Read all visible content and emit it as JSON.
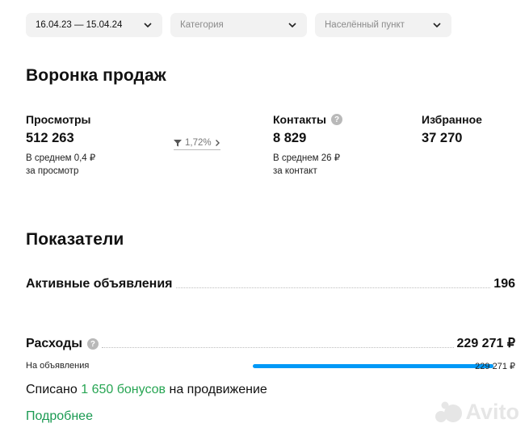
{
  "filters": {
    "date": "16.04.23 — 15.04.24",
    "category": "Категория",
    "location": "Населённый пункт"
  },
  "funnel": {
    "title": "Воронка продаж",
    "views": {
      "label": "Просмотры",
      "value": "512 263",
      "sub1": "В среднем 0,4 ₽",
      "sub2": "за просмотр"
    },
    "conversion": "1,72%",
    "contacts": {
      "label": "Контакты",
      "value": "8 829",
      "sub1": "В среднем 26 ₽",
      "sub2": "за контакт"
    },
    "favorites": {
      "label": "Избранное",
      "value": "37 270"
    }
  },
  "indicators": {
    "title": "Показатели",
    "active_label": "Активные объявления",
    "active_value": "196",
    "expenses_label": "Расходы",
    "expenses_value": "229 271 ₽",
    "ads_label": "На объявления",
    "ads_value": "229 271 ₽",
    "ads_fraction": 1.0,
    "written_prefix": "Списано",
    "written_bonus": "1 650 бонусов",
    "written_suffix": "на продвижение",
    "more_link": "Подробнее"
  },
  "watermark": "Avito",
  "colors": {
    "accent_blue": "#0099f7",
    "green": "#27a553"
  }
}
